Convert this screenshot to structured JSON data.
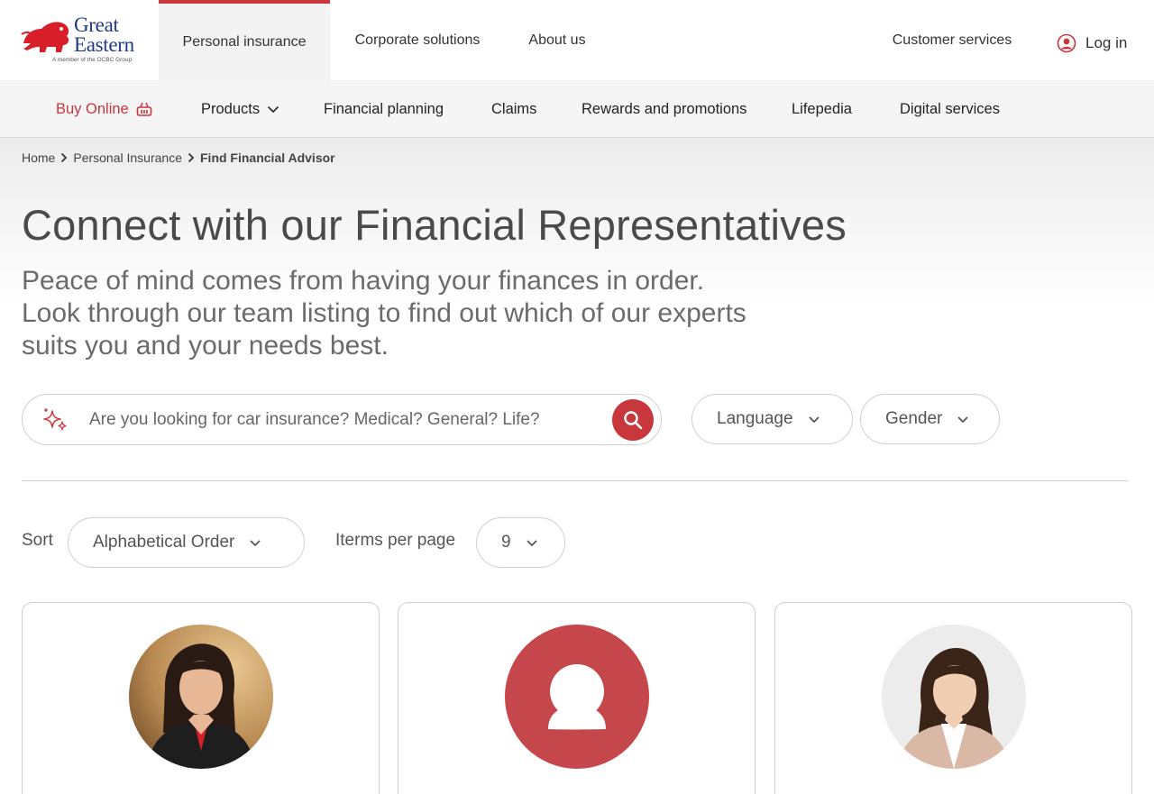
{
  "brand": {
    "name_line1": "Great",
    "name_line2": "Eastern",
    "tagline": "A member of the OCBC Group"
  },
  "top_nav": {
    "tabs": [
      {
        "label": "Personal insurance",
        "active": true
      },
      {
        "label": "Corporate solutions",
        "active": false
      },
      {
        "label": "About us",
        "active": false
      }
    ],
    "customer_services": "Customer services",
    "login": "Log in"
  },
  "sub_nav": {
    "buy_online": "Buy Online",
    "products": "Products",
    "financial_planning": "Financial planning",
    "claims": "Claims",
    "rewards": "Rewards and promotions",
    "lifepedia": "Lifepedia",
    "digital": "Digital services"
  },
  "breadcrumb": [
    "Home",
    "Personal Insurance",
    "Find Financial Advisor"
  ],
  "hero": {
    "title": "Connect with our Financial Representatives",
    "subtitle_line1": "Peace of mind comes from having your finances in order.",
    "subtitle_line2": "Look through our team listing to find out which of our experts",
    "subtitle_line3": "suits you and your needs best."
  },
  "search": {
    "placeholder": "Are you looking for car insurance? Medical? General? Life?",
    "value": ""
  },
  "filters": {
    "language": "Language",
    "gender": "Gender"
  },
  "sorting": {
    "sort_label": "Sort",
    "sort_value": "Alphabetical Order",
    "items_per_page_label": "Iterms per page",
    "items_per_page_value": "9"
  },
  "colors": {
    "accent": "#c8373c",
    "brand_blue": "#1d3a8a",
    "subnav_bg": "#f5f5f5"
  },
  "icons": {
    "cart": "shopping-basket-icon",
    "user": "user-circle-icon",
    "search": "search-icon",
    "sparkle": "sparkle-icon",
    "chevron": "chevron-down-icon",
    "breadcrumb_sep": "chevron-right-icon"
  }
}
